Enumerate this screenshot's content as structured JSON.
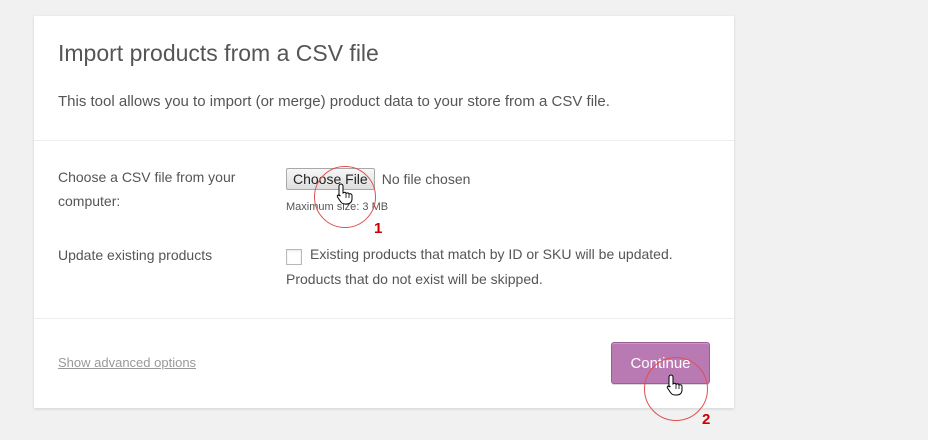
{
  "header": {
    "title": "Import products from a CSV file",
    "description": "This tool allows you to import (or merge) product data to your store from a CSV file."
  },
  "file_row": {
    "label": "Choose a CSV file from your computer:",
    "button_label": "Choose File",
    "status": "No file chosen",
    "max_size": "Maximum size: 3 MB"
  },
  "update_row": {
    "label": "Update existing products",
    "checked": false,
    "checkbox_text_line1": "Existing products that match by ID or SKU will be updated.",
    "checkbox_text_line2": "Products that do not exist will be skipped."
  },
  "footer": {
    "advanced_link": "Show advanced options",
    "continue_label": "Continue"
  },
  "annotations": {
    "step1": "1",
    "step2": "2"
  },
  "colors": {
    "accent": "#b97ab4",
    "annotation": "#cc0000"
  }
}
